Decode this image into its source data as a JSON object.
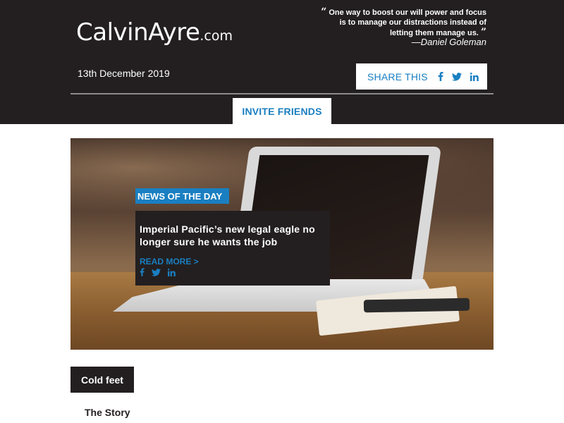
{
  "header": {
    "logo_main": "CalvinAyre",
    "logo_suffix": ".com",
    "quote_text": "One way to boost our will power and focus is to manage our distractions instead of letting them manage us.",
    "quote_open": "“",
    "quote_close": "”",
    "quote_author": "—Daniel Goleman",
    "date": "13th December 2019",
    "share_label": "SHARE THIS",
    "share_icons": [
      "facebook-icon",
      "twitter-icon",
      "linkedin-icon"
    ],
    "invite_label": "INVITE FRIENDS"
  },
  "hero": {
    "tag": "NEWS OF THE DAY",
    "title": "Imperial Pacific’s new legal eagle no longer sure he wants the job",
    "read_more": "READ MORE >",
    "icons": [
      "facebook-icon",
      "twitter-icon",
      "linkedin-icon"
    ]
  },
  "section": {
    "tag": "Cold feet",
    "story_label": "The Story"
  },
  "colors": {
    "header_bg": "#231f20",
    "accent_blue": "#1a7fc1",
    "white": "#ffffff"
  }
}
